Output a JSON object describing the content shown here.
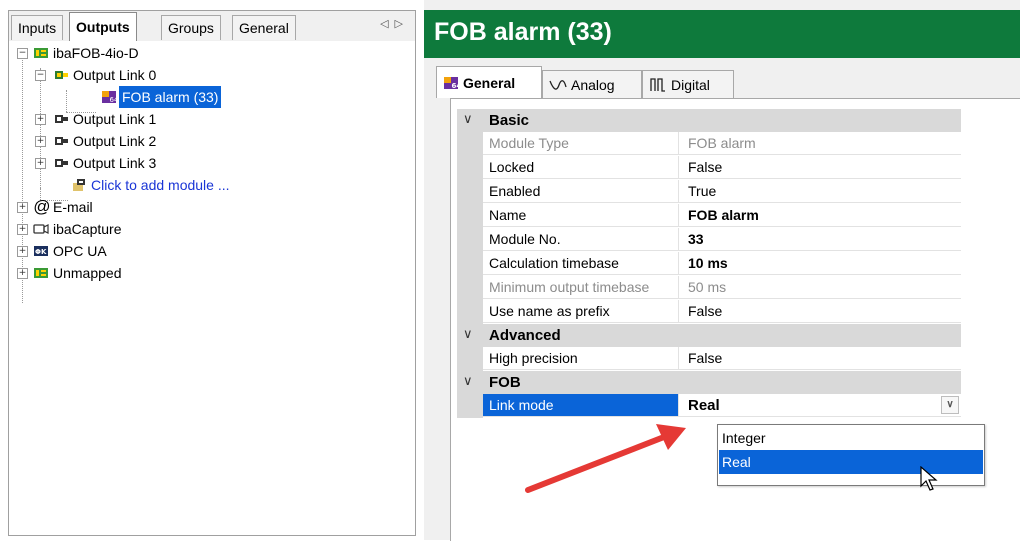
{
  "left_tabs": {
    "inputs": "Inputs",
    "outputs": "Outputs",
    "groups": "Groups",
    "general": "General"
  },
  "tree": {
    "device": "ibaFOB-4io-D",
    "output_link_0": "Output Link 0",
    "fob_alarm": "FOB alarm (33)",
    "output_link_1": "Output Link 1",
    "output_link_2": "Output Link 2",
    "output_link_3": "Output Link 3",
    "add_module": "Click to add module ...",
    "email": "E-mail",
    "capture": "ibaCapture",
    "opcua": "OPC UA",
    "unmapped": "Unmapped"
  },
  "title": "FOB alarm (33)",
  "right_tabs": {
    "general": "General",
    "analog": "Analog",
    "digital": "Digital"
  },
  "categories": {
    "basic": "Basic",
    "advanced": "Advanced",
    "fob": "FOB"
  },
  "props": {
    "module_type": {
      "name": "Module Type",
      "value": "FOB alarm"
    },
    "locked": {
      "name": "Locked",
      "value": "False"
    },
    "enabled": {
      "name": "Enabled",
      "value": "True"
    },
    "name": {
      "name": "Name",
      "value": "FOB alarm"
    },
    "module_no": {
      "name": "Module No.",
      "value": "33"
    },
    "calc_timebase": {
      "name": "Calculation timebase",
      "value": "10 ms"
    },
    "min_output_timebase": {
      "name": "Minimum output timebase",
      "value": "50 ms"
    },
    "use_name_prefix": {
      "name": "Use name as prefix",
      "value": "False"
    },
    "high_precision": {
      "name": "High precision",
      "value": "False"
    },
    "link_mode": {
      "name": "Link mode",
      "value": "Real"
    }
  },
  "link_mode_options": [
    "Integer",
    "Real"
  ],
  "colors": {
    "title_bar": "#0e7a3c",
    "selection": "#0a64d8",
    "annotation_arrow": "#e53935"
  },
  "icons": {
    "device": "ibafob-device-icon",
    "link": "output-link-icon",
    "module": "fob-module-icon",
    "email": "at-sign-icon",
    "capture": "camera-icon",
    "opcua": "opcua-icon"
  }
}
